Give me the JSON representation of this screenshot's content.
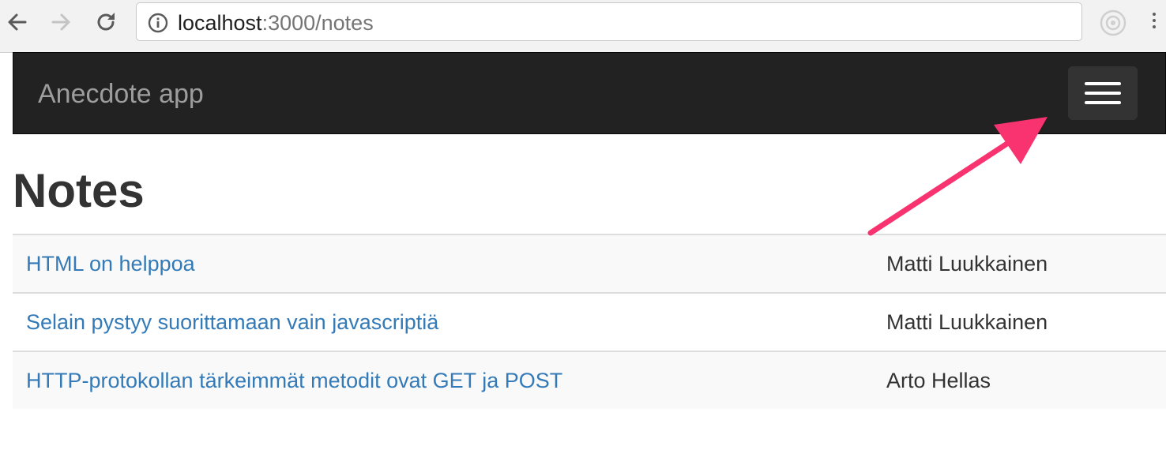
{
  "browser": {
    "url_host": "localhost",
    "url_rest": ":3000/notes",
    "icons": {
      "back": "arrow-left-icon",
      "forward": "arrow-right-icon",
      "reload": "reload-icon",
      "info": "info-icon",
      "extension": "extension-icon",
      "menu": "vertical-dots-icon"
    }
  },
  "navbar": {
    "brand": "Anecdote app",
    "toggle_icon": "hamburger-icon",
    "background": "#222222"
  },
  "page": {
    "title": "Notes",
    "notes": [
      {
        "content": "HTML on helppoa",
        "user": "Matti Luukkainen"
      },
      {
        "content": "Selain pystyy suorittamaan vain javascriptiä",
        "user": "Matti Luukkainen"
      },
      {
        "content": "HTTP-protokollan tärkeimmät metodit ovat GET ja POST",
        "user": "Arto Hellas"
      }
    ]
  },
  "colors": {
    "link": "#337ab7",
    "annotation_arrow": "#f8336f"
  }
}
